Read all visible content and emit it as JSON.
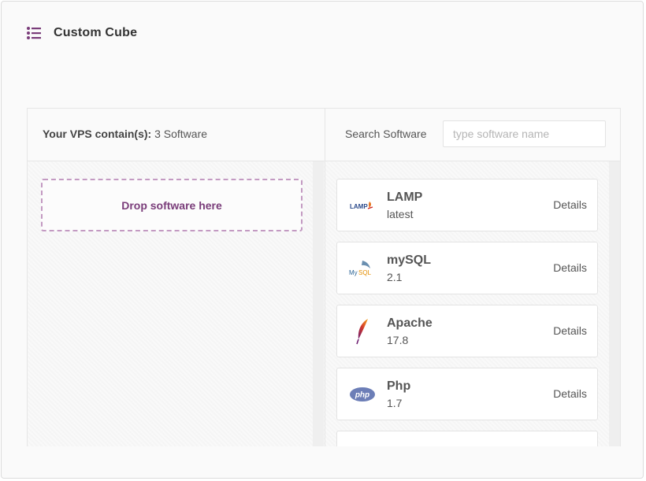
{
  "app": {
    "title": "Custom Cube",
    "menu_icon": "list-icon"
  },
  "vps": {
    "label": "Your VPS contain(s):",
    "count_text": "3 Software",
    "drop_zone_text": "Drop software here"
  },
  "search": {
    "label": "Search Software",
    "placeholder": "type software name",
    "value": ""
  },
  "software": [
    {
      "name": "LAMP",
      "version": "latest",
      "details_label": "Details",
      "icon": "lamp-logo"
    },
    {
      "name": "mySQL",
      "version": "2.1",
      "details_label": "Details",
      "icon": "mysql-logo"
    },
    {
      "name": "Apache",
      "version": "17.8",
      "details_label": "Details",
      "icon": "apache-feather-logo"
    },
    {
      "name": "Php",
      "version": "1.7",
      "details_label": "Details",
      "icon": "php-logo"
    }
  ],
  "colors": {
    "accent": "#7a3d7a",
    "drop_border": "#c39ac2"
  }
}
